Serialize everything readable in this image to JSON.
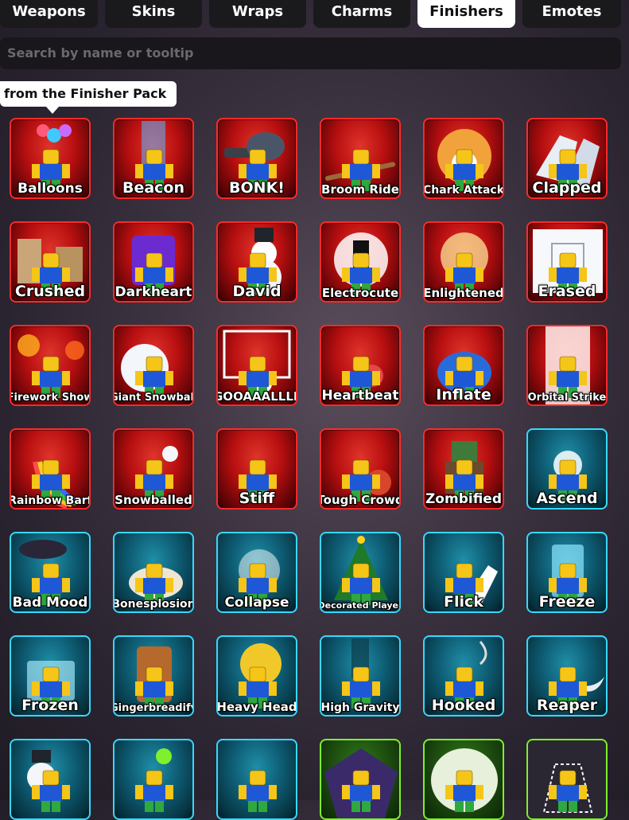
{
  "tabs": [
    {
      "label": "Weapons",
      "active": false
    },
    {
      "label": "Skins",
      "active": false
    },
    {
      "label": "Wraps",
      "active": false
    },
    {
      "label": "Charms",
      "active": false
    },
    {
      "label": "Finishers",
      "active": true
    },
    {
      "label": "Emotes",
      "active": false
    }
  ],
  "search": {
    "placeholder": "Search by name or tooltip",
    "value": ""
  },
  "tooltip": {
    "text": "from the Finisher Pack"
  },
  "items": [
    {
      "name": "Balloons",
      "rarity": "red",
      "icon": "balloons-icon"
    },
    {
      "name": "Beacon",
      "rarity": "red",
      "icon": "beacon-icon"
    },
    {
      "name": "BONK!",
      "rarity": "red",
      "icon": "bonk-icon"
    },
    {
      "name": "Broom Ride",
      "rarity": "red",
      "icon": "broom-ride-icon"
    },
    {
      "name": "Chark Attack",
      "rarity": "red",
      "icon": "chark-attack-icon"
    },
    {
      "name": "Clapped",
      "rarity": "red",
      "icon": "clapped-icon"
    },
    {
      "name": "Crushed",
      "rarity": "red",
      "icon": "crushed-icon"
    },
    {
      "name": "Darkheart",
      "rarity": "red",
      "icon": "darkheart-icon"
    },
    {
      "name": "David",
      "rarity": "red",
      "icon": "david-icon"
    },
    {
      "name": "Electrocute",
      "rarity": "red",
      "icon": "electrocute-icon"
    },
    {
      "name": "Enlightened",
      "rarity": "red",
      "icon": "enlightened-icon"
    },
    {
      "name": "Erased",
      "rarity": "red",
      "icon": "erased-icon"
    },
    {
      "name": "Firework Show",
      "rarity": "red",
      "icon": "firework-show-icon"
    },
    {
      "name": "Giant Snowball",
      "rarity": "red",
      "icon": "giant-snowball-icon"
    },
    {
      "name": "GOOAAALLLL",
      "rarity": "red",
      "icon": "goal-icon"
    },
    {
      "name": "Heartbeat",
      "rarity": "red",
      "icon": "heartbeat-icon"
    },
    {
      "name": "Inflate",
      "rarity": "red",
      "icon": "inflate-icon"
    },
    {
      "name": "Orbital Strike",
      "rarity": "red",
      "icon": "orbital-strike-icon"
    },
    {
      "name": "Rainbow Barf",
      "rarity": "red",
      "icon": "rainbow-barf-icon"
    },
    {
      "name": "Snowballed",
      "rarity": "red",
      "icon": "snowballed-icon"
    },
    {
      "name": "Stiff",
      "rarity": "red",
      "icon": "stiff-icon"
    },
    {
      "name": "Tough Crowd",
      "rarity": "red",
      "icon": "tough-crowd-icon"
    },
    {
      "name": "Zombified",
      "rarity": "red",
      "icon": "zombified-icon"
    },
    {
      "name": "Ascend",
      "rarity": "cyan",
      "icon": "ascend-icon"
    },
    {
      "name": "Bad Mood",
      "rarity": "cyan",
      "icon": "bad-mood-icon"
    },
    {
      "name": "Bonesplosion",
      "rarity": "cyan",
      "icon": "bonesplosion-icon"
    },
    {
      "name": "Collapse",
      "rarity": "cyan",
      "icon": "collapse-icon"
    },
    {
      "name": "Decorated Player",
      "rarity": "cyan",
      "icon": "decorated-player-icon"
    },
    {
      "name": "Flick",
      "rarity": "cyan",
      "icon": "flick-icon"
    },
    {
      "name": "Freeze",
      "rarity": "cyan",
      "icon": "freeze-icon"
    },
    {
      "name": "Frozen",
      "rarity": "cyan",
      "icon": "frozen-icon"
    },
    {
      "name": "Gingerbreadify",
      "rarity": "cyan",
      "icon": "gingerbreadify-icon"
    },
    {
      "name": "Heavy Head",
      "rarity": "cyan",
      "icon": "heavy-head-icon"
    },
    {
      "name": "High Gravity",
      "rarity": "cyan",
      "icon": "high-gravity-icon"
    },
    {
      "name": "Hooked",
      "rarity": "cyan",
      "icon": "hooked-icon"
    },
    {
      "name": "Reaper",
      "rarity": "cyan",
      "icon": "reaper-icon"
    },
    {
      "name": "",
      "rarity": "cyan",
      "icon": "snowman-player-icon"
    },
    {
      "name": "",
      "rarity": "cyan",
      "icon": "splat-player-icon"
    },
    {
      "name": "",
      "rarity": "cyan",
      "icon": "crossed-arms-player-icon"
    },
    {
      "name": "",
      "rarity": "green",
      "icon": "vampire-icon"
    },
    {
      "name": "",
      "rarity": "green",
      "icon": "monster-mouth-icon"
    },
    {
      "name": "",
      "rarity": "green",
      "icon": "crime-scene-icon"
    }
  ],
  "colors": {
    "red_border": "#ff2a2a",
    "cyan_border": "#38d8ff",
    "green_border": "#7ef02c",
    "active_tab_bg": "#ffffff",
    "tab_bg": "#1a1a1c"
  }
}
